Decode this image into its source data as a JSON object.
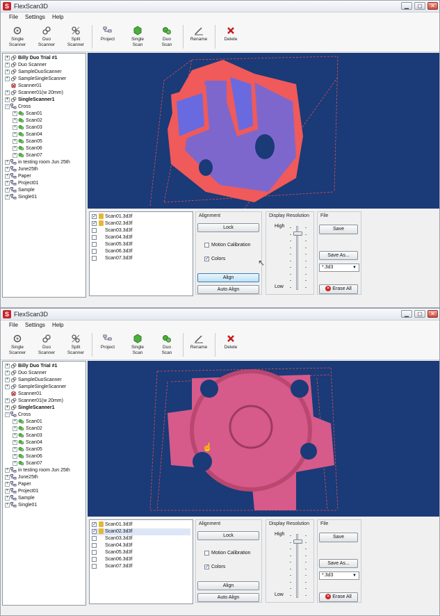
{
  "colors": {
    "viewport_bg": "#1a3a78",
    "scan_red": "#f05a5a",
    "scan_blue": "#6a6ae0",
    "box_line": "#e05050"
  },
  "app": {
    "title": "FlexScan3D",
    "icon": "flexscan-logo-icon"
  },
  "window_buttons": {
    "minimize": "▁",
    "maximize": "▢",
    "close": "✕"
  },
  "menu": [
    "File",
    "Settings",
    "Help"
  ],
  "toolbar": [
    {
      "label": "Single\nScanner",
      "icon": "single-scanner-icon"
    },
    {
      "label": "Duo\nScanner",
      "icon": "duo-scanner-icon"
    },
    {
      "label": "Split\nScanner",
      "icon": "split-scanner-icon"
    },
    {
      "label": "Project",
      "icon": "project-icon"
    },
    {
      "label": "Single\nScan",
      "icon": "single-scan-icon"
    },
    {
      "label": "Duo\nScan",
      "icon": "duo-scan-icon"
    },
    {
      "label": "Rename",
      "icon": "rename-icon"
    },
    {
      "label": "Delete",
      "icon": "delete-icon"
    }
  ],
  "tree": [
    {
      "label": "Billy Duo Trial #1",
      "bold": true,
      "level": 0,
      "exp": "+",
      "icon": "scanner-icon"
    },
    {
      "label": "Duo Scanner",
      "bold": false,
      "level": 0,
      "exp": "+",
      "icon": "scanner-icon"
    },
    {
      "label": "SampleDuoScanner",
      "bold": false,
      "level": 0,
      "exp": "+",
      "icon": "scanner-icon"
    },
    {
      "label": "SampleSingleScanner",
      "bold": false,
      "level": 0,
      "exp": "+",
      "icon": "scanner-icon"
    },
    {
      "label": "Scanner01",
      "bold": false,
      "level": 0,
      "exp": "",
      "icon": "scanner-error-icon"
    },
    {
      "label": "Scanner01(w 20mm)",
      "bold": false,
      "level": 0,
      "exp": "+",
      "icon": "scanner-icon"
    },
    {
      "label": "SingleScanner1",
      "bold": true,
      "level": 0,
      "exp": "+",
      "icon": "scanner-icon"
    },
    {
      "label": "Cross",
      "bold": false,
      "level": 0,
      "exp": "−",
      "icon": "project-icon"
    },
    {
      "label": "Scan01",
      "bold": false,
      "level": 1,
      "exp": "+",
      "icon": "scan-icon"
    },
    {
      "label": "Scan02",
      "bold": false,
      "level": 1,
      "exp": "+",
      "icon": "scan-icon"
    },
    {
      "label": "Scan03",
      "bold": false,
      "level": 1,
      "exp": "+",
      "icon": "scan-icon"
    },
    {
      "label": "Scan04",
      "bold": false,
      "level": 1,
      "exp": "+",
      "icon": "scan-icon"
    },
    {
      "label": "Scan05",
      "bold": false,
      "level": 1,
      "exp": "+",
      "icon": "scan-icon"
    },
    {
      "label": "Scan06",
      "bold": false,
      "level": 1,
      "exp": "+",
      "icon": "scan-icon"
    },
    {
      "label": "Scan07",
      "bold": false,
      "level": 1,
      "exp": "+",
      "icon": "scan-icon"
    },
    {
      "label": "in testing room Jun 25th",
      "bold": false,
      "level": 0,
      "exp": "+",
      "icon": "project-icon"
    },
    {
      "label": "June25th",
      "bold": false,
      "level": 0,
      "exp": "+",
      "icon": "project-icon"
    },
    {
      "label": "Paper",
      "bold": false,
      "level": 0,
      "exp": "+",
      "icon": "project-icon"
    },
    {
      "label": "Project01",
      "bold": false,
      "level": 0,
      "exp": "+",
      "icon": "project-icon"
    },
    {
      "label": "Sample",
      "bold": false,
      "level": 0,
      "exp": "+",
      "icon": "project-icon"
    },
    {
      "label": "Single01",
      "bold": false,
      "level": 0,
      "exp": "+",
      "icon": "project-icon"
    }
  ],
  "files": [
    {
      "label": "Scan01.3d3f",
      "checked": true,
      "locked": true
    },
    {
      "label": "Scan02.3d3f",
      "checked": true,
      "locked": true
    },
    {
      "label": "Scan03.3d3f",
      "checked": false,
      "locked": false
    },
    {
      "label": "Scan04.3d3f",
      "checked": false,
      "locked": false
    },
    {
      "label": "Scan05.3d3f",
      "checked": false,
      "locked": false
    },
    {
      "label": "Scan06.3d3f",
      "checked": false,
      "locked": false
    },
    {
      "label": "Scan07.3d3f",
      "checked": false,
      "locked": false
    }
  ],
  "alignment": {
    "title": "Alignment",
    "lock": "Lock",
    "motion_calibration": "Motion Calibration",
    "motion_calibration_checked": false,
    "colors": "Colors",
    "colors_checked": true,
    "align": "Align",
    "auto_align": "Auto Align"
  },
  "resolution": {
    "title": "Display Resolution",
    "high": "High",
    "low": "Low",
    "level": 1.0
  },
  "file_group": {
    "title": "File",
    "save": "Save",
    "save_as": "Save As...",
    "format": "*.3d3",
    "erase_all": "Erase All"
  },
  "checkmark": "✓"
}
